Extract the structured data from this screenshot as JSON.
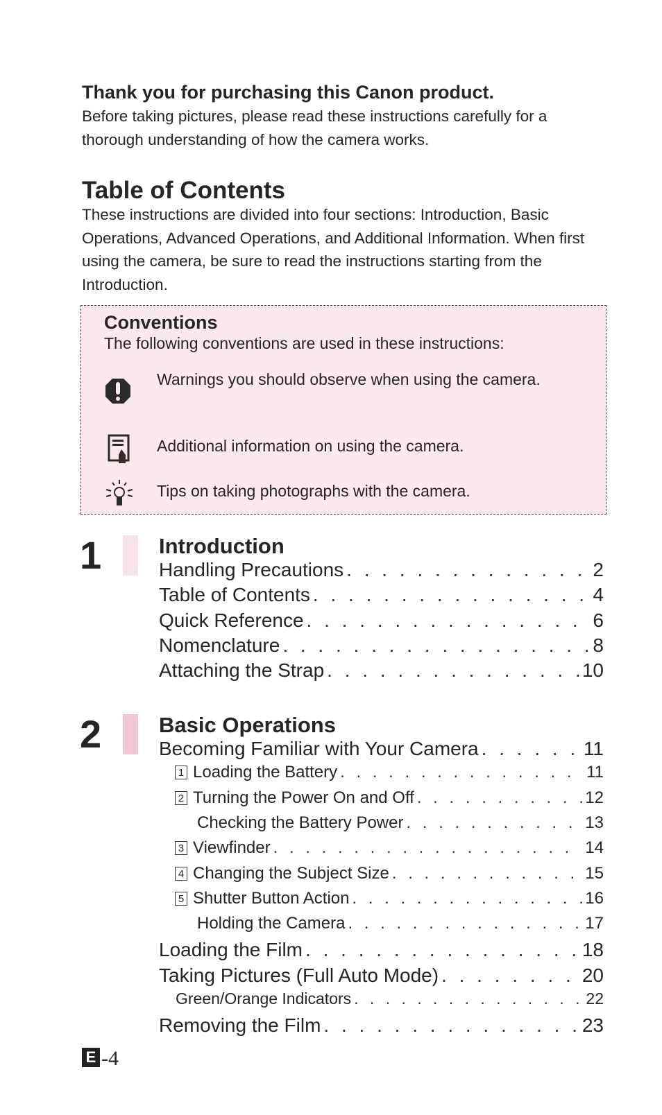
{
  "intro": {
    "heading": "Thank you for purchasing this Canon product.",
    "text": "Before taking pictures, please read these instructions carefully for a thorough understanding of how the camera works."
  },
  "toc": {
    "heading": "Table of Contents",
    "text": "These instructions are divided into four sections: Introduction, Basic Operations, Advanced Operations, and Additional Information. When first using the camera, be sure to read the instructions starting from the Introduction."
  },
  "conventions": {
    "title": "Conventions",
    "intro": "The following conventions are used in these instructions:",
    "items": [
      {
        "icon": "warning-icon",
        "text": "Warnings you should observe when using the camera."
      },
      {
        "icon": "memo-icon",
        "text": "Additional information on using the camera."
      },
      {
        "icon": "lightbulb-icon",
        "text": "Tips on taking photographs with the camera."
      }
    ]
  },
  "sections": [
    {
      "number": "1",
      "title": "Introduction",
      "tab_color": "#f6e4e8",
      "entries": [
        {
          "label": "Handling Precautions",
          "page": "2",
          "level": 0
        },
        {
          "label": "Table of Contents",
          "page": "4",
          "level": 0
        },
        {
          "label": "Quick Reference",
          "page": "6",
          "level": 0
        },
        {
          "label": "Nomenclature",
          "page": "8",
          "level": 0
        },
        {
          "label": "Attaching the Strap",
          "page": "10",
          "level": 0
        }
      ]
    },
    {
      "number": "2",
      "title": "Basic Operations",
      "tab_color": "#f2c6d2",
      "entries": [
        {
          "label": "Becoming Familiar with Your Camera",
          "page": "11",
          "level": 0
        },
        {
          "label": "Loading the Battery",
          "page": "11",
          "level": 1,
          "step": "1"
        },
        {
          "label": "Turning the Power On and Off",
          "page": "12",
          "level": 1,
          "step": "2"
        },
        {
          "label": "Checking the Battery Power",
          "page": "13",
          "level": 1
        },
        {
          "label": "Viewfinder",
          "page": "14",
          "level": 1,
          "step": "3"
        },
        {
          "label": "Changing the Subject Size",
          "page": "15",
          "level": 1,
          "step": "4"
        },
        {
          "label": "Shutter Button Action",
          "page": "16",
          "level": 1,
          "step": "5"
        },
        {
          "label": "Holding the Camera",
          "page": "17",
          "level": 1
        },
        {
          "label": "Loading the Film",
          "page": "18",
          "level": 0
        },
        {
          "label": "Taking Pictures (Full Auto Mode)",
          "page": "20",
          "level": 0
        },
        {
          "label": "Green/Orange Indicators",
          "page": "22",
          "level": 2
        },
        {
          "label": "Removing the Film",
          "page": "23",
          "level": 0
        }
      ]
    }
  ],
  "footer": {
    "badge": "E",
    "page": "-4"
  },
  "colors": {
    "conventions_bg": "#fbe9ed",
    "text": "#262424"
  }
}
